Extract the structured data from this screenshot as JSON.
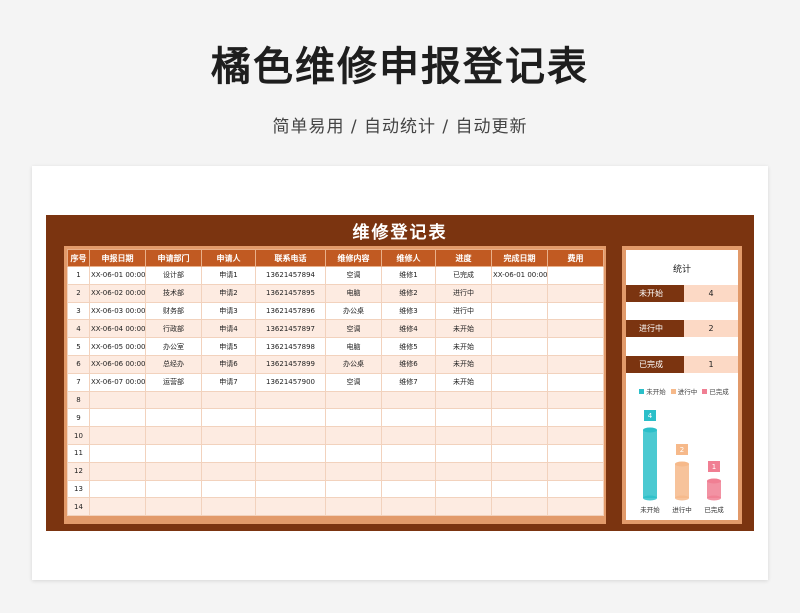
{
  "page": {
    "title": "橘色维修申报登记表",
    "subtitle": "简单易用 / 自动统计 / 自动更新"
  },
  "sheet": {
    "title": "维修登记表",
    "headers": [
      "序号",
      "申报日期",
      "申请部门",
      "申请人",
      "联系电话",
      "维修内容",
      "维修人",
      "进度",
      "完成日期",
      "费用"
    ],
    "rows": [
      [
        "1",
        "XX-06-01 00:00:00",
        "设计部",
        "申请1",
        "13621457894",
        "空调",
        "维修1",
        "已完成",
        "XX-06-01 00:00:00",
        ""
      ],
      [
        "2",
        "XX-06-02 00:00:00",
        "技术部",
        "申请2",
        "13621457895",
        "电脑",
        "维修2",
        "进行中",
        "",
        ""
      ],
      [
        "3",
        "XX-06-03 00:00:00",
        "财务部",
        "申请3",
        "13621457896",
        "办公桌",
        "维修3",
        "进行中",
        "",
        ""
      ],
      [
        "4",
        "XX-06-04 00:00:00",
        "行政部",
        "申请4",
        "13621457897",
        "空调",
        "维修4",
        "未开始",
        "",
        ""
      ],
      [
        "5",
        "XX-06-05 00:00:00",
        "办公室",
        "申请5",
        "13621457898",
        "电脑",
        "维修5",
        "未开始",
        "",
        ""
      ],
      [
        "6",
        "XX-06-06 00:00:00",
        "总经办",
        "申请6",
        "13621457899",
        "办公桌",
        "维修6",
        "未开始",
        "",
        ""
      ],
      [
        "7",
        "XX-06-07 00:00:00",
        "运营部",
        "申请7",
        "13621457900",
        "空调",
        "维修7",
        "未开始",
        "",
        ""
      ],
      [
        "8",
        "",
        "",
        "",
        "",
        "",
        "",
        "",
        "",
        ""
      ],
      [
        "9",
        "",
        "",
        "",
        "",
        "",
        "",
        "",
        "",
        ""
      ],
      [
        "10",
        "",
        "",
        "",
        "",
        "",
        "",
        "",
        "",
        ""
      ],
      [
        "11",
        "",
        "",
        "",
        "",
        "",
        "",
        "",
        "",
        ""
      ],
      [
        "12",
        "",
        "",
        "",
        "",
        "",
        "",
        "",
        "",
        ""
      ],
      [
        "13",
        "",
        "",
        "",
        "",
        "",
        "",
        "",
        "",
        ""
      ],
      [
        "14",
        "",
        "",
        "",
        "",
        "",
        "",
        "",
        "",
        ""
      ]
    ]
  },
  "stats": {
    "title": "统计",
    "items": [
      {
        "label": "未开始",
        "value": "4"
      },
      {
        "label": "进行中",
        "value": "2"
      },
      {
        "label": "已完成",
        "value": "1"
      }
    ]
  },
  "chart_data": {
    "type": "bar",
    "categories": [
      "未开始",
      "进行中",
      "已完成"
    ],
    "values": [
      4,
      2,
      1
    ],
    "legend": [
      "未开始",
      "进行中",
      "已完成"
    ],
    "colors": [
      "#2bbfc9",
      "#f6b98a",
      "#f07f93"
    ],
    "ylim": [
      0,
      4
    ]
  }
}
